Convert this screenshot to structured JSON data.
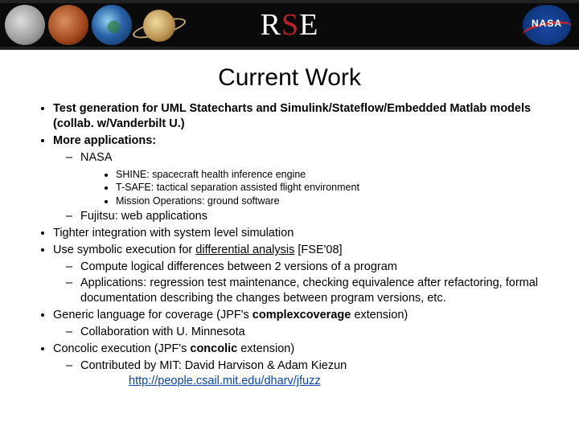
{
  "header": {
    "logo_r": "R",
    "logo_s": "S",
    "logo_e": "E",
    "nasa": "NASA"
  },
  "title": "Current Work",
  "bullets": {
    "b1": "Test generation for UML Statecharts and Simulink/Stateflow/Embedded Matlab models (collab. w/Vanderbilt U.)",
    "b2": "More applications:",
    "b2_sub1": "NASA",
    "b2_sub1_a": "SHINE: spacecraft health inference engine",
    "b2_sub1_b": "T-SAFE: tactical separation assisted flight environment",
    "b2_sub1_c": "Mission Operations: ground software",
    "b2_sub2": "Fujitsu: web applications",
    "b3_pre": "Tighter integration with system level simulation",
    "b4_pre": "Use symbolic execution for ",
    "b4_underline": "differential analysis",
    "b4_post": " [FSE'08]",
    "b4_sub1": "Compute logical differences between 2 versions of a program",
    "b4_sub2": "Applications: regression test maintenance, checking equivalence after refactoring, formal documentation describing the changes between program versions, etc.",
    "b5_pre": "Generic language for coverage (JPF's ",
    "b5_bold": "complexcoverage",
    "b5_post": " extension)",
    "b5_sub1": "Collaboration with U. Minnesota",
    "b6_pre": "Concolic execution (JPF's ",
    "b6_bold": "concolic",
    "b6_post": " extension)",
    "b6_sub1": "Contributed by MIT: David Harvison & Adam Kiezun",
    "b6_link": "http://people.csail.mit.edu/dharv/jfuzz"
  }
}
